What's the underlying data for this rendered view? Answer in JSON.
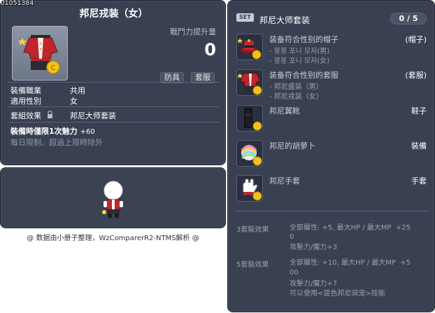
{
  "item_id": "01051384",
  "item": {
    "name": "邦尼戎装（女）",
    "power_label": "戰鬥力提升量",
    "power_value": "0",
    "tags": [
      "防具",
      "套服"
    ],
    "stats": [
      {
        "key": "裝備職業",
        "value": "共用"
      },
      {
        "key": "適用性別",
        "value": "女"
      }
    ],
    "set_label": "套組效果",
    "set_value": "邦尼大师套装",
    "charm_label": "裝備時僅限1次魅力",
    "charm_value": "+60",
    "expire_text": "每日限制、超過上限時除外"
  },
  "footer_note": "@ 数据由小册子整理，WzComparerR2-NTMS解析 @",
  "set_panel": {
    "badge": "SET",
    "name": "邦尼大师套装",
    "count": "0 / 5",
    "pieces": [
      {
        "name": "装备符合性别的帽子",
        "type": "(帽子)",
        "subs": [
          "- 붕붕 포니 모자(男)",
          "- 붕붕 포니 모자(女)"
        ]
      },
      {
        "name": "装备符合性别的套服",
        "type": "(套服)",
        "subs": [
          "- 邦尼盛装（男）",
          "- 邦尼戎装（女）"
        ]
      },
      {
        "name": "邦尼翼靴",
        "type": "鞋子",
        "subs": []
      },
      {
        "name": "邦尼的胡萝卜",
        "type": "裝備",
        "subs": []
      },
      {
        "name": "邦尼手套",
        "type": "手套",
        "subs": []
      }
    ],
    "effects": [
      {
        "label": "3套裝效果",
        "lines": [
          "全部屬性: +5, 最大HP / 最大MP  +25",
          "0",
          "攻擊力/魔力+3"
        ]
      },
      {
        "label": "5套裝效果",
        "lines": [
          "全部屬性: +10, 最大HP / 最大MP  +5",
          "00",
          "攻擊力/魔力+7",
          "可以使用<蓝色邦尼骑宠>技能"
        ]
      }
    ]
  },
  "colors": {
    "panel_bg": "#384052",
    "panel_border": "#1a1f29",
    "text_primary": "#ffffff",
    "text_muted": "#9aa1ae",
    "outfit_red": "#c0262c",
    "coin_gold": "#f2c318"
  },
  "icons": {
    "item": "red-outfit-icon",
    "lock": "lock-icon",
    "hat": "red-hat-icon",
    "outfit": "red-outfit-icon",
    "shoes": "black-boot-icon",
    "carrot": "rainbow-carrot-icon",
    "gloves": "white-glove-icon",
    "coin": "gold-coin-icon"
  }
}
